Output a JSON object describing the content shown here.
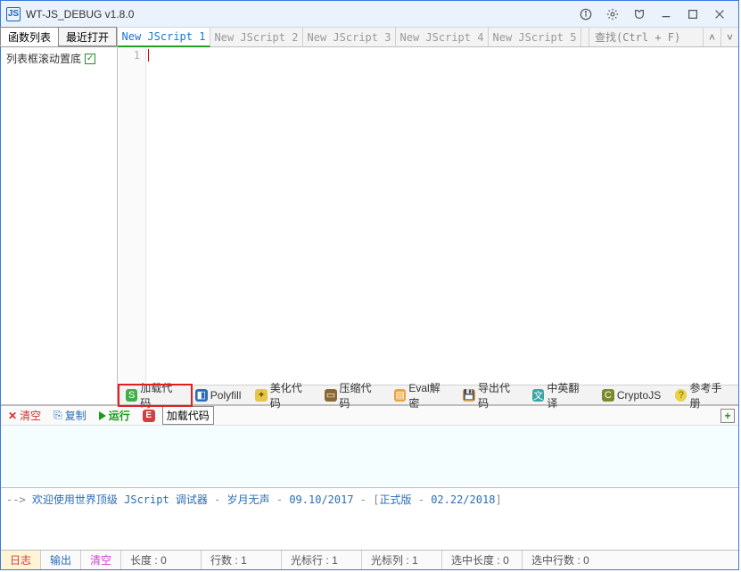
{
  "title": "WT-JS_DEBUG v1.8.0",
  "titlebar_icons": [
    "info",
    "settings",
    "shirt",
    "minimize",
    "maximize",
    "close"
  ],
  "sidebar": {
    "tabs": [
      "函数列表",
      "最近打开"
    ],
    "active_tab": 0,
    "scroll_bottom_label": "列表框滚动置底",
    "scroll_bottom_checked": true
  },
  "file_tabs": {
    "items": [
      "New JScript 1",
      "New JScript 2",
      "New JScript 3",
      "New JScript 4",
      "New JScript 5"
    ],
    "active": 0
  },
  "search_placeholder": "查找(Ctrl + F)",
  "gutter_lines": [
    "1"
  ],
  "editor_toolbar": {
    "items": [
      {
        "icon": "ic-green",
        "glyph": "S",
        "label": "加载代码"
      },
      {
        "icon": "ic-blue",
        "glyph": "◧",
        "label": "Polyfill"
      },
      {
        "icon": "ic-yellow",
        "glyph": "✦",
        "label": "美化代码"
      },
      {
        "icon": "ic-brown",
        "glyph": "▭",
        "label": "压缩代码"
      },
      {
        "icon": "ic-orange",
        "glyph": "▤",
        "label": "Eval解密"
      },
      {
        "icon": "ic-orange",
        "glyph": "💾",
        "label": "导出代码"
      },
      {
        "icon": "ic-teal",
        "glyph": "文",
        "label": "中英翻译"
      },
      {
        "icon": "ic-olive",
        "glyph": "C",
        "label": "CryptoJS"
      },
      {
        "icon": "ic-help",
        "glyph": "?",
        "label": "参考手册"
      }
    ]
  },
  "output_toolbar": {
    "clear": "清空",
    "copy": "复制",
    "run": "运行",
    "tooltip": "加载代码"
  },
  "log_line": {
    "prefix": "--> ",
    "t1": "欢迎使用世界顶级 JScript 调试器",
    "sep": " - ",
    "t2": "岁月无声",
    "date1": "09.10/2017",
    "brk": " - [",
    "t3": "正式版",
    "date2": "02.22/2018",
    "end": "]"
  },
  "bottom_tabs": {
    "log": "日志",
    "output": "输出",
    "clear": "清空"
  },
  "status": [
    {
      "k": "长度",
      "v": "0"
    },
    {
      "k": "行数",
      "v": "1"
    },
    {
      "k": "光标行",
      "v": "1"
    },
    {
      "k": "光标列",
      "v": "1"
    },
    {
      "k": "选中长度",
      "v": "0"
    },
    {
      "k": "选中行数",
      "v": "0"
    }
  ]
}
